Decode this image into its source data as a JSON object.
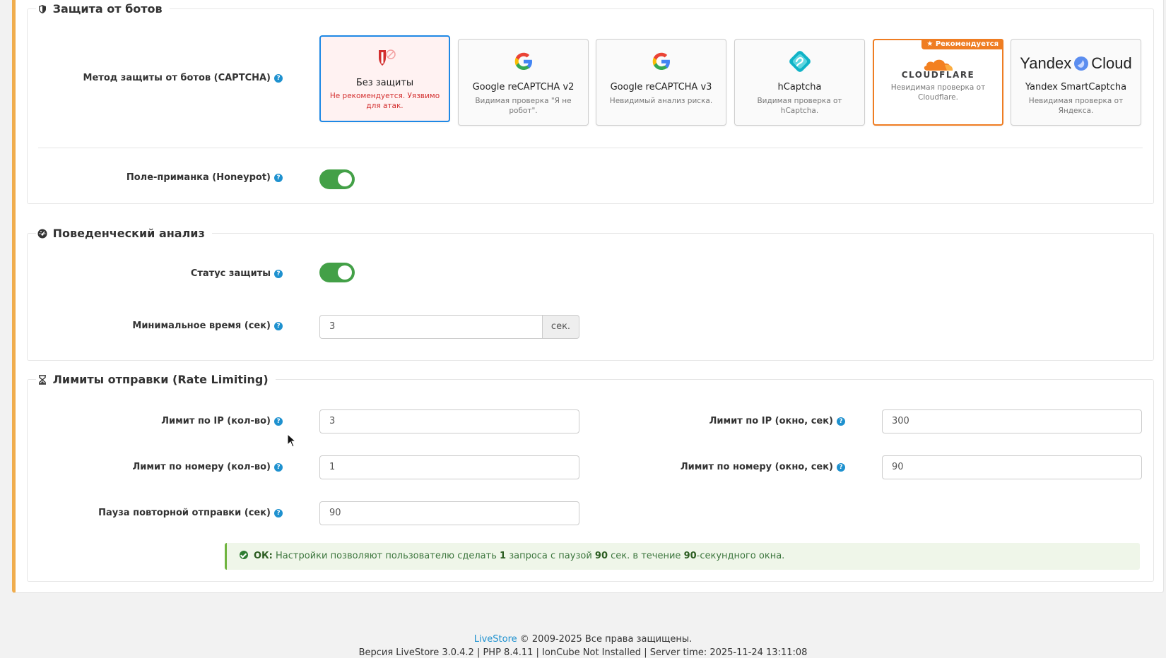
{
  "sections": {
    "bots": {
      "legend": "Защита от ботов",
      "captcha_label": "Метод защиты от ботов (CAPTCHA)",
      "honeypot_label": "Поле-приманка (Honeypot)",
      "honeypot_on": true,
      "options": [
        {
          "title": "Без защиты",
          "desc": "Не рекомендуется. Уязвимо для атак.",
          "selected": true,
          "icon": "shield-off-icon"
        },
        {
          "title": "Google reCAPTCHA v2",
          "desc": "Видимая проверка \"Я не робот\".",
          "icon": "google-icon"
        },
        {
          "title": "Google reCAPTCHA v3",
          "desc": "Невидимый анализ риска.",
          "icon": "google-icon"
        },
        {
          "title": "hCaptcha",
          "desc": "Видимая проверка от hCaptcha.",
          "icon": "hcaptcha-icon"
        },
        {
          "title": "",
          "logo_text": "CLOUDFLARE",
          "desc": "Невидимая проверка от Cloudflare.",
          "badge": "Рекомендуется",
          "icon": "cloudflare-icon"
        },
        {
          "title": "Yandex SmartCaptcha",
          "logo_left": "Yandex",
          "logo_right": "Cloud",
          "desc": "Невидимая проверка от Яндекса.",
          "icon": "yandex-cloud-icon"
        }
      ]
    },
    "behavior": {
      "legend": "Поведенческий анализ",
      "status_label": "Статус защиты",
      "status_on": true,
      "min_time_label": "Минимальное время (сек)",
      "min_time_value": "3",
      "min_time_unit": "сек."
    },
    "rate": {
      "legend": "Лимиты отправки (Rate Limiting)",
      "ip_count_label": "Лимит по IP (кол-во)",
      "ip_count_value": "3",
      "ip_window_label": "Лимит по IP (окно, сек)",
      "ip_window_value": "300",
      "phone_count_label": "Лимит по номеру (кол-во)",
      "phone_count_value": "1",
      "phone_window_label": "Лимит по номеру (окно, сек)",
      "phone_window_value": "90",
      "resend_label": "Пауза повторной отправки (сек)",
      "resend_value": "90",
      "alert": {
        "ok": "ОК:",
        "t1": "Настройки позволяют пользователю сделать",
        "n1": "1",
        "t2": "запроса с паузой",
        "n2": "90",
        "t3": "сек. в течение",
        "n3": "90",
        "t4": "-секундного окна."
      }
    }
  },
  "help_glyph": "?",
  "footer": {
    "brand": "LiveStore",
    "copyright": "© 2009-2025 Все права защищены.",
    "version_line": "Версия LiveStore 3.0.4.2 | PHP 8.4.11 | IonCube Not Installed | Server time: 2025-11-24 13:11:08"
  },
  "colors": {
    "accent": "#f0ad4e",
    "toggle_on": "#43a047",
    "selected_border": "#1e88e5",
    "recommended": "#ef7d22",
    "help": "#1e91cf"
  }
}
